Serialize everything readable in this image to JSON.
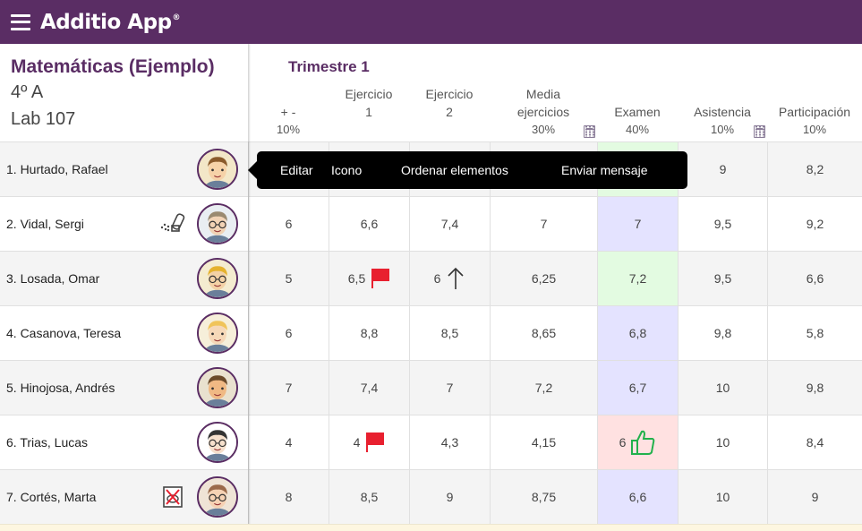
{
  "app": {
    "title": "Additio App",
    "trademark": "®"
  },
  "course": {
    "name": "Matemáticas (Ejemplo)",
    "group": "4º A",
    "room": "Lab 107"
  },
  "term": {
    "title": "Trimestre 1"
  },
  "columns": [
    {
      "id": "plusminus",
      "title_lines": [
        "+ -"
      ],
      "percent": "10%",
      "calculated": false
    },
    {
      "id": "ej1",
      "title_lines": [
        "Ejercicio",
        "1"
      ],
      "percent": "",
      "calculated": false
    },
    {
      "id": "ej2",
      "title_lines": [
        "Ejercicio",
        "2"
      ],
      "percent": "",
      "calculated": false
    },
    {
      "id": "media",
      "title_lines": [
        "Media",
        "ejercicios"
      ],
      "percent": "30%",
      "calculated": true
    },
    {
      "id": "examen",
      "title_lines": [
        "Examen"
      ],
      "percent": "40%",
      "calculated": false
    },
    {
      "id": "asistencia",
      "title_lines": [
        "Asistencia"
      ],
      "percent": "10%",
      "calculated": true
    },
    {
      "id": "participacion",
      "title_lines": [
        "Participación"
      ],
      "percent": "10%",
      "calculated": false
    }
  ],
  "context_menu": {
    "items": [
      "Editar",
      "Icono",
      "Ordenar elementos",
      "Enviar mensaje"
    ]
  },
  "students": [
    {
      "name": "1. Hurtado, Rafael",
      "status_icon": "",
      "avatar": "curly-hair-avatar",
      "grades": [
        "",
        "",
        "",
        "",
        "",
        "9",
        "8,2"
      ],
      "exam_color": "green",
      "marks": {}
    },
    {
      "name": "2. Vidal, Sergi",
      "status_icon": "inhaler-icon",
      "avatar": "glasses-avatar",
      "grades": [
        "6",
        "6,6",
        "7,4",
        "7",
        "7",
        "9,5",
        "9,2"
      ],
      "exam_color": "blue",
      "marks": {}
    },
    {
      "name": "3. Losada, Omar",
      "status_icon": "",
      "avatar": "blond-glasses-avatar",
      "grades": [
        "5",
        "6,5",
        "6",
        "6,25",
        "7,2",
        "9,5",
        "6,6"
      ],
      "exam_color": "green",
      "marks": {
        "ej1": "flag-icon",
        "ej2": "arrow-up-icon"
      }
    },
    {
      "name": "4. Casanova, Teresa",
      "status_icon": "",
      "avatar": "blonde-girl-avatar",
      "grades": [
        "6",
        "8,8",
        "8,5",
        "8,65",
        "6,8",
        "9,8",
        "5,8"
      ],
      "exam_color": "blue",
      "marks": {}
    },
    {
      "name": "5. Hinojosa, Andrés",
      "status_icon": "",
      "avatar": "headphones-avatar",
      "grades": [
        "7",
        "7,4",
        "7",
        "7,2",
        "6,7",
        "10",
        "9,8"
      ],
      "exam_color": "blue",
      "marks": {}
    },
    {
      "name": "6. Trias, Lucas",
      "status_icon": "",
      "avatar": "dark-hair-glasses-avatar",
      "grades": [
        "4",
        "4",
        "4,3",
        "4,15",
        "6",
        "10",
        "8,4"
      ],
      "exam_color": "red",
      "marks": {
        "ej1": "flag-icon",
        "examen": "thumbs-up-icon"
      }
    },
    {
      "name": "7. Cortés, Marta",
      "status_icon": "no-food-icon",
      "avatar": "red-glasses-avatar",
      "grades": [
        "8",
        "8,5",
        "9",
        "8,75",
        "6,6",
        "10",
        "9"
      ],
      "exam_color": "blue",
      "marks": {}
    }
  ],
  "colors": {
    "brand": "#5a2d64",
    "exam_green": "#e3fbe1",
    "exam_blue": "#e4e3ff",
    "exam_red": "#ffe1e1",
    "flag": "#e8202f",
    "thumb": "#22b14c"
  }
}
